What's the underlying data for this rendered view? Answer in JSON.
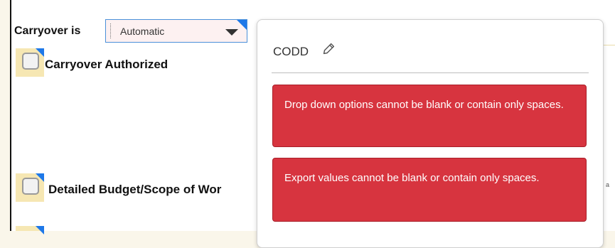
{
  "form": {
    "carryover_label": "Carryover is",
    "carryover_value": "Automatic",
    "items": [
      {
        "label": "Carryover Authorized"
      },
      {
        "label": "Detailed Budget/Scope of Wor"
      }
    ],
    "edge_text": "a"
  },
  "popup": {
    "title": "CODD",
    "edit_icon": "pencil-icon",
    "errors": [
      {
        "message": "Drop down options cannot be blank or contain only spaces."
      },
      {
        "message": "Export values cannot be blank or contain only spaces."
      }
    ]
  },
  "colors": {
    "error_bg": "#d7343f",
    "accent_corner": "#1e78e8",
    "checkbox_bg": "#f6e7b3",
    "dropdown_border": "#4a90d9",
    "dropdown_bg": "#fdf1f1"
  }
}
